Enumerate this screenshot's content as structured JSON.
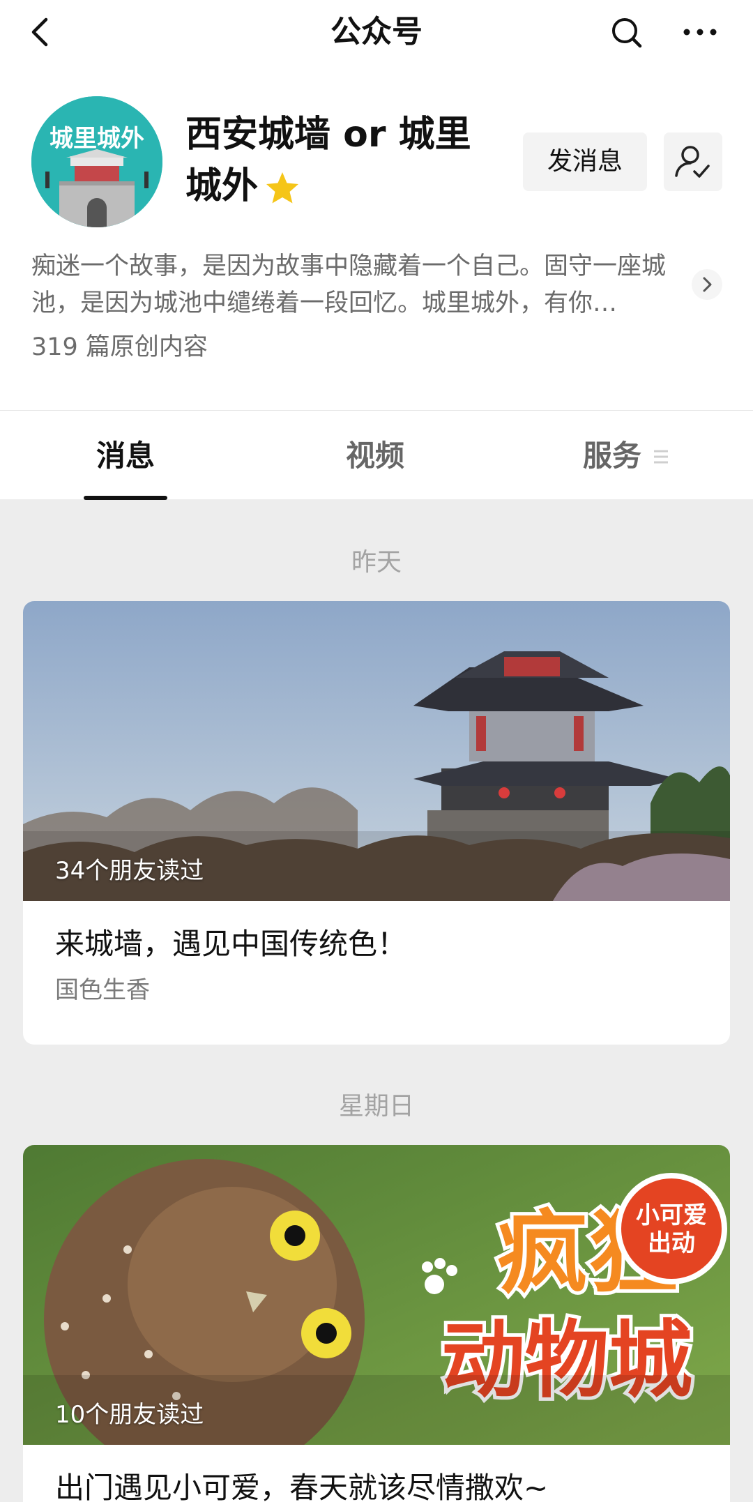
{
  "nav": {
    "title": "公众号",
    "back_icon": "chevron-left-icon",
    "search_icon": "search-icon",
    "more_icon": "more-horizontal-icon"
  },
  "profile": {
    "avatar_text": "城里城外",
    "name": "西安城墙 or 城里城外",
    "verified_icon": "star-icon",
    "message_button": "发消息",
    "follow_icon": "followed-user-icon",
    "description": "痴迷一个故事，是因为故事中隐藏着一个自己。固守一座城池，是因为城池中缱绻着一段回忆。城里城外，有你…",
    "original_count": "319 篇原创内容"
  },
  "tabs": [
    {
      "label": "消息",
      "active": true
    },
    {
      "label": "视频",
      "active": false
    },
    {
      "label": "服务",
      "active": false
    }
  ],
  "feed": [
    {
      "date": "昨天",
      "read_count": "34个朋友读过",
      "title": "来城墙，遇见中国传统色！",
      "subtitle": "国色生香"
    },
    {
      "date": "星期日",
      "read_count": "10个朋友读过",
      "title": "出门遇见小可爱，春天就该尽情撒欢~",
      "image_text_main": "疯狂动物城",
      "image_badge": "小可爱出动"
    }
  ],
  "colors": {
    "accent_star": "#f5c518",
    "avatar_bg": "#2ab5b2",
    "page_bg": "#ededed"
  }
}
